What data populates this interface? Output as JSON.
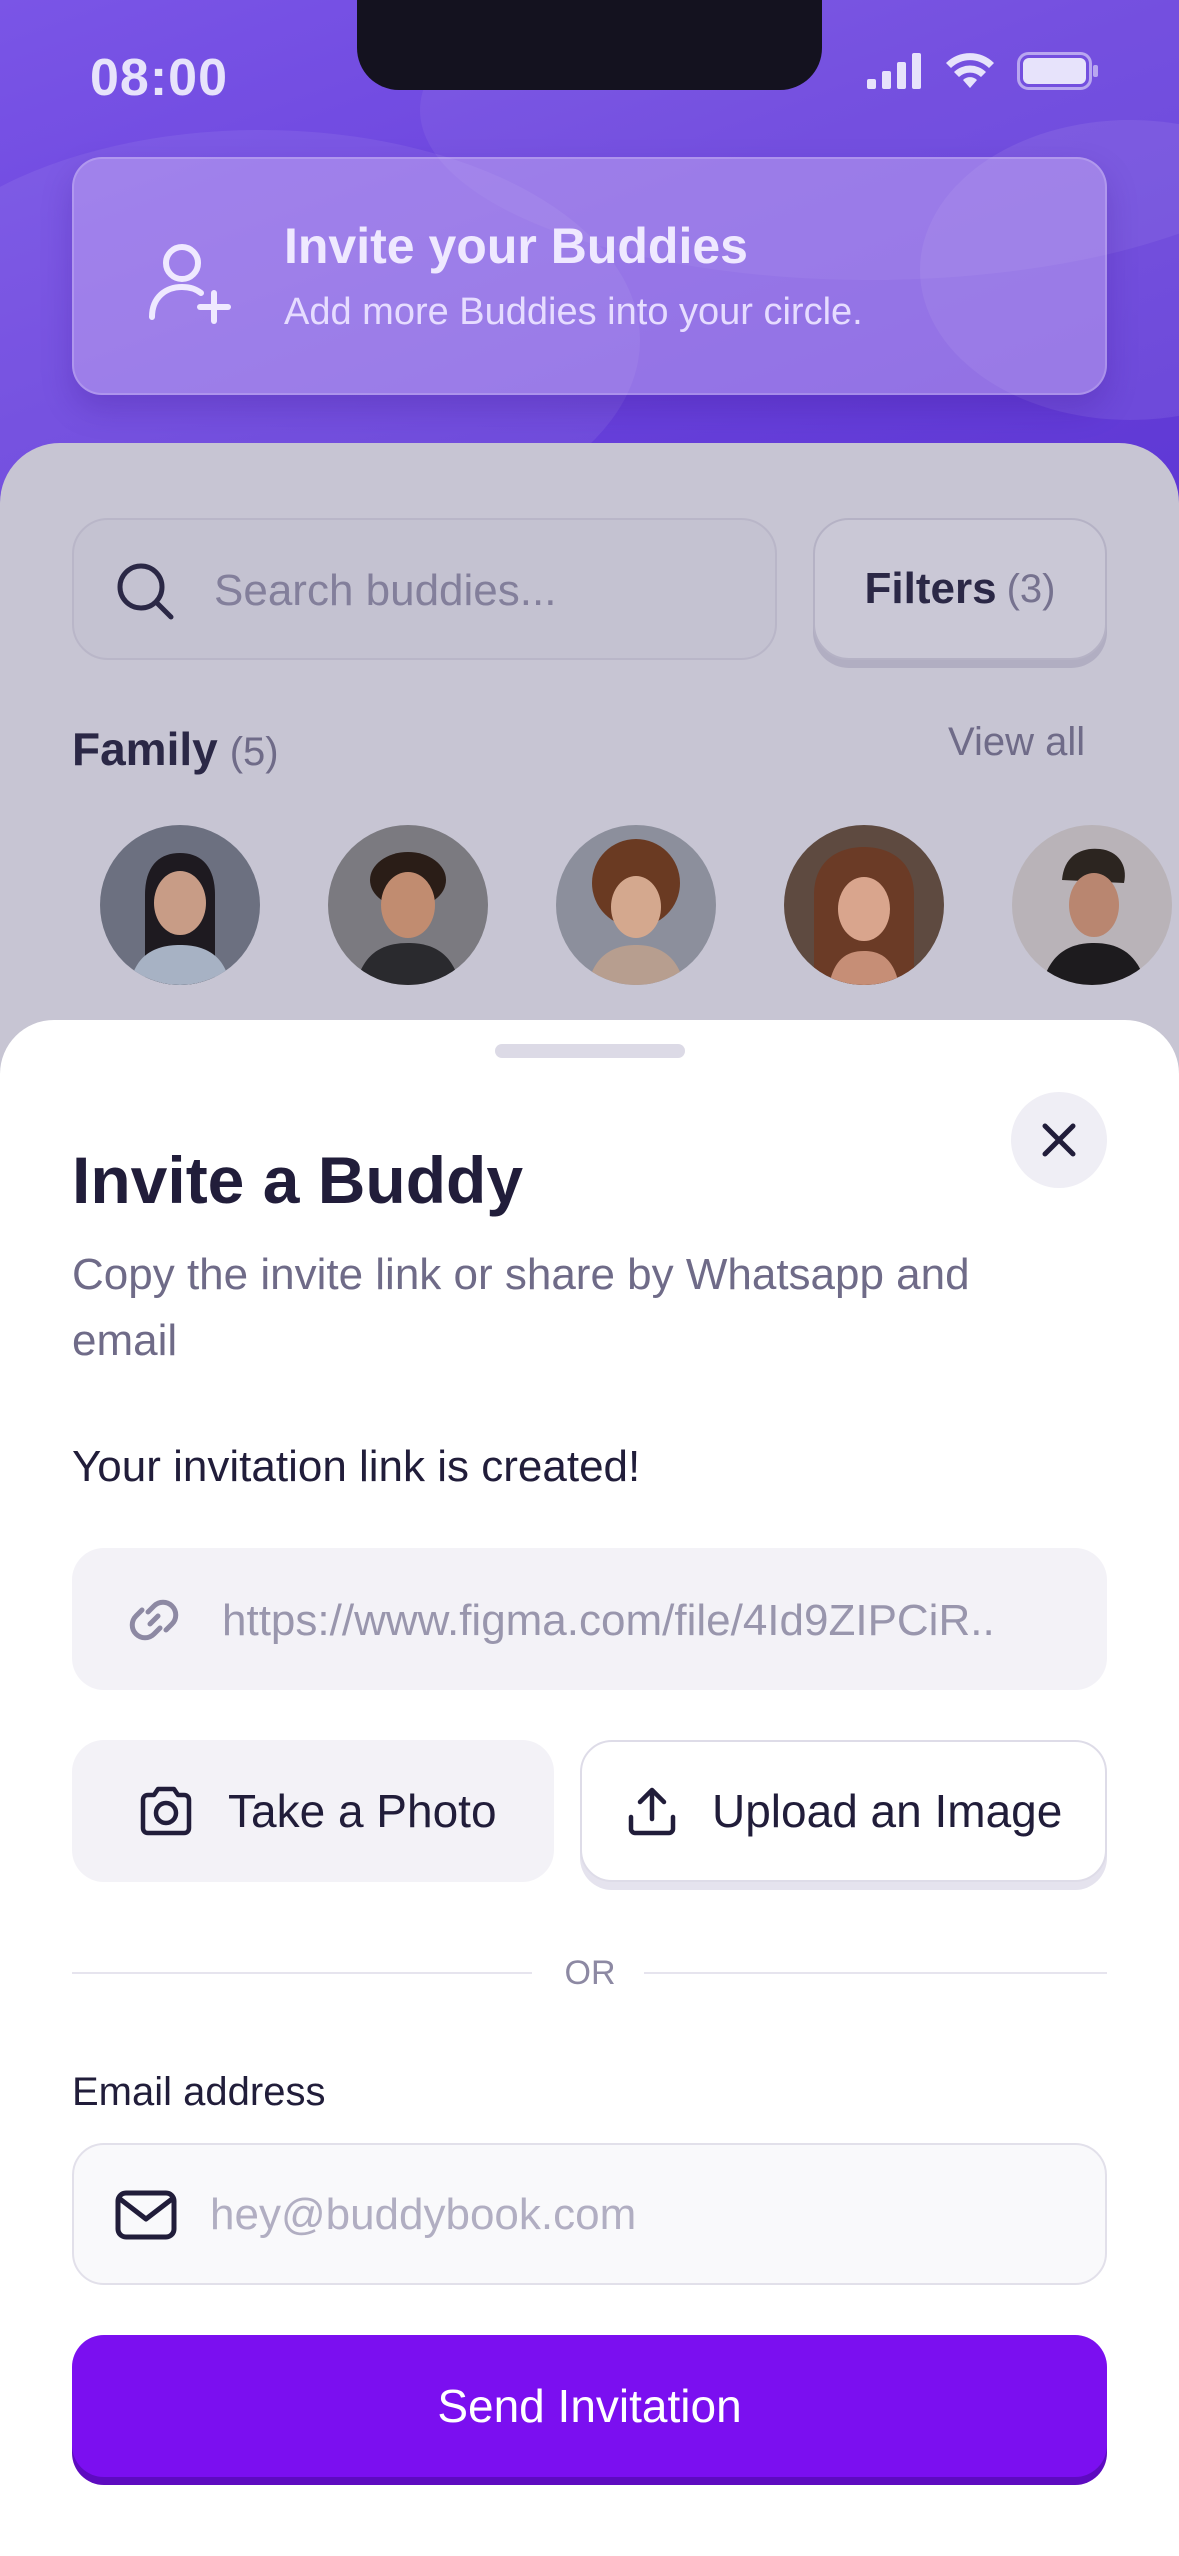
{
  "status_bar": {
    "time": "08:00"
  },
  "banner": {
    "title": "Invite your Buddies",
    "subtitle": "Add more Buddies into your circle.",
    "icon": "user-plus-icon"
  },
  "search": {
    "placeholder": "Search buddies..."
  },
  "filters": {
    "label": "Filters",
    "count": "(3)"
  },
  "family": {
    "label": "Family",
    "count": "(5)",
    "view_all": "View all",
    "avatars": [
      "avatar-1",
      "avatar-2",
      "avatar-3",
      "avatar-4",
      "avatar-5"
    ]
  },
  "sheet": {
    "title": "Invite a Buddy",
    "subtitle": "Copy the invite link or share by Whatsapp and email",
    "link_created": "Your invitation link is created!",
    "link_value": "https://www.figma.com/file/4Id9ZIPCiR..",
    "take_photo_label": "Take a Photo",
    "upload_label": "Upload an Image",
    "or_label": "OR",
    "email_label": "Email address",
    "email_placeholder": "hey@buddybook.com",
    "send_label": "Send Invitation"
  },
  "colors": {
    "primary": "#7b0ff0",
    "header_purple": "#6c45de",
    "text_dark": "#211d3a",
    "text_muted": "#6f6b88"
  }
}
